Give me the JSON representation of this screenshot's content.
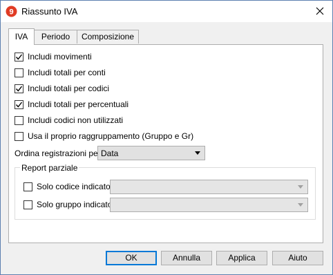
{
  "window": {
    "title": "Riassunto IVA"
  },
  "tabs": [
    {
      "label": "IVA",
      "active": true
    },
    {
      "label": "Periodo",
      "active": false
    },
    {
      "label": "Composizione",
      "active": false
    }
  ],
  "options": [
    {
      "label": "Includi movimenti",
      "checked": true
    },
    {
      "label": "Includi totali per conti",
      "checked": false
    },
    {
      "label": "Includi totali per codici",
      "checked": true
    },
    {
      "label": "Includi totali per percentuali",
      "checked": true
    },
    {
      "label": "Includi codici non utilizzati",
      "checked": false
    },
    {
      "label": "Usa il proprio raggruppamento (Gruppo e Gr)",
      "checked": false
    }
  ],
  "sort": {
    "label": "Ordina registrazioni per",
    "value": "Data"
  },
  "partial_report": {
    "title": "Report parziale",
    "code": {
      "label": "Solo codice indicato",
      "checked": false,
      "value": ""
    },
    "group": {
      "label": "Solo gruppo indicato",
      "checked": false,
      "value": ""
    }
  },
  "buttons": {
    "ok": "OK",
    "cancel": "Annulla",
    "apply": "Applica",
    "help": "Aiuto"
  },
  "icons": {
    "app": "banana-app-icon",
    "close": "close-icon",
    "check": "check-icon",
    "dropdown": "chevron-down-icon"
  },
  "colors": {
    "default_button_border": "#0078d7",
    "app_icon": "#e03b24"
  }
}
